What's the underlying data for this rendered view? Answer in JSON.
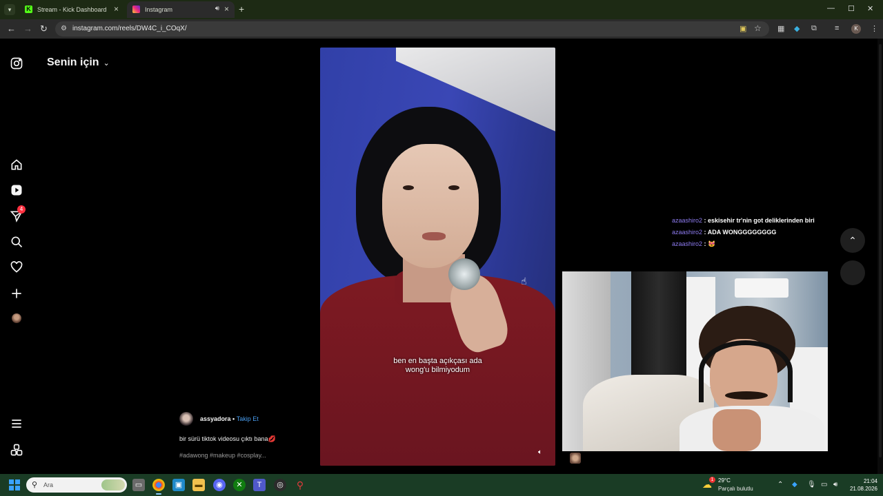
{
  "browser": {
    "tabs": [
      {
        "label": "Stream - Kick Dashboard",
        "favicon": "K"
      },
      {
        "label": "Instagram"
      }
    ],
    "url": "instagram.com/reels/DW4C_i_COqX/",
    "profile_initial": "K"
  },
  "sidebar": {
    "notifications_count": "4"
  },
  "feed": {
    "title": "Senin için"
  },
  "reel": {
    "subtitle_line1": "ben en başta açıkçası ada",
    "subtitle_line2": "wong'u bilmiyodum",
    "author": "assyadora",
    "separator": " • ",
    "follow_label": "Takip Et",
    "caption": "bir sürü tiktok videosu çıktı bana",
    "caption_emoji": "💋",
    "hashtags": "#adawong #makeup #cosplay..."
  },
  "chat": {
    "messages": [
      {
        "user": "azaashiro2",
        "text": "eskisehir tr'nin got deliklerinden biri"
      },
      {
        "user": "azaashiro2",
        "text": "ADA WONGGGGGGGG"
      },
      {
        "user": "azaashiro2",
        "text": "😻"
      }
    ],
    "separator": " : "
  },
  "taskbar": {
    "search_placeholder": "Ara",
    "weather_temp": "29°C",
    "weather_condition": "Parçalı bulutlu",
    "weather_badge": "1",
    "time": "21:04",
    "date": "21.08.2026"
  },
  "colors": {
    "kick_green": "#53fc18",
    "link_blue": "#4a9ef0",
    "chat_nick": "#8d7bf0",
    "badge_red": "#ff3040"
  }
}
